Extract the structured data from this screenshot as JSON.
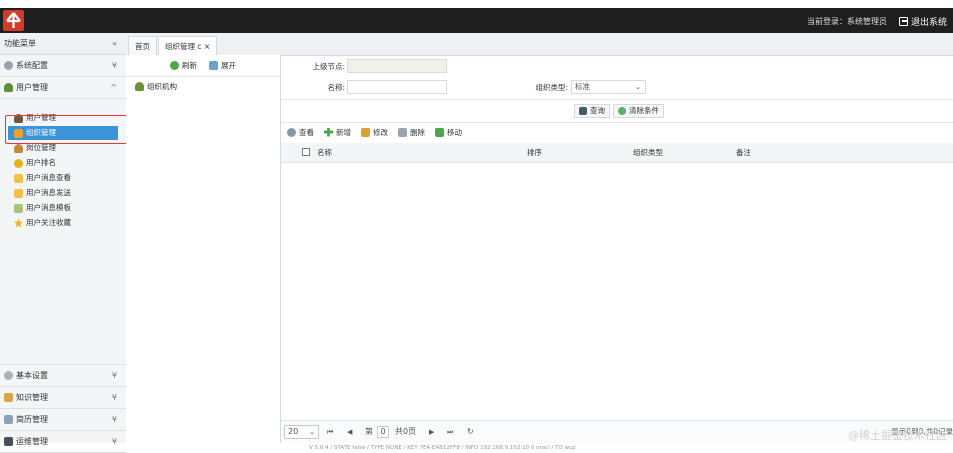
{
  "header": {
    "current_login": "当前登录：系统管理员",
    "logout": "退出系统"
  },
  "sidebar": {
    "title": "功能菜单",
    "groups": [
      {
        "label": "系统配置"
      },
      {
        "label": "用户管理"
      }
    ],
    "items": [
      {
        "label": "用户管理"
      },
      {
        "label": "组织管理"
      },
      {
        "label": "岗位管理"
      },
      {
        "label": "用户排名"
      },
      {
        "label": "用户消息查看"
      },
      {
        "label": "用户消息发送"
      },
      {
        "label": "用户消息模板"
      },
      {
        "label": "用户关注收藏"
      }
    ],
    "bottom_groups": [
      {
        "label": "基本设置"
      },
      {
        "label": "知识管理"
      },
      {
        "label": "简历管理"
      },
      {
        "label": "运维管理"
      }
    ]
  },
  "tabs": [
    {
      "label": "首页"
    },
    {
      "label": "组织管理 c ×"
    }
  ],
  "tree": {
    "refresh": "刷新",
    "expand": "展开",
    "root": "组织机构"
  },
  "form": {
    "parent_label": "上级节点:",
    "parent_value": "",
    "name_label": "名称:",
    "name_value": "",
    "type_label": "组织类型:",
    "type_value": "标准"
  },
  "buttons": {
    "query": "查询",
    "clear": "清除条件"
  },
  "actions": {
    "view": "查看",
    "add": "新增",
    "edit": "修改",
    "delete": "删除",
    "move": "移动"
  },
  "grid": {
    "columns": [
      "名称",
      "排序",
      "组织类型",
      "备注"
    ]
  },
  "pager": {
    "page_size": "20",
    "first": "⏮",
    "prev": "◀",
    "page_prefix": "第",
    "page_value": "0",
    "page_total": "共0页",
    "next": "▶",
    "last": "⏭",
    "refresh": "↻",
    "summary": "显示0到0,共0记录"
  },
  "footer": {
    "version": "V 5.0.4 / STATE false / TYPE NONE / KEY 7E4-EAB12FF8 / INFO 192.168.0.102:10 0 oracl / TO wcp"
  },
  "watermark": "@稀土掘金技术社区"
}
